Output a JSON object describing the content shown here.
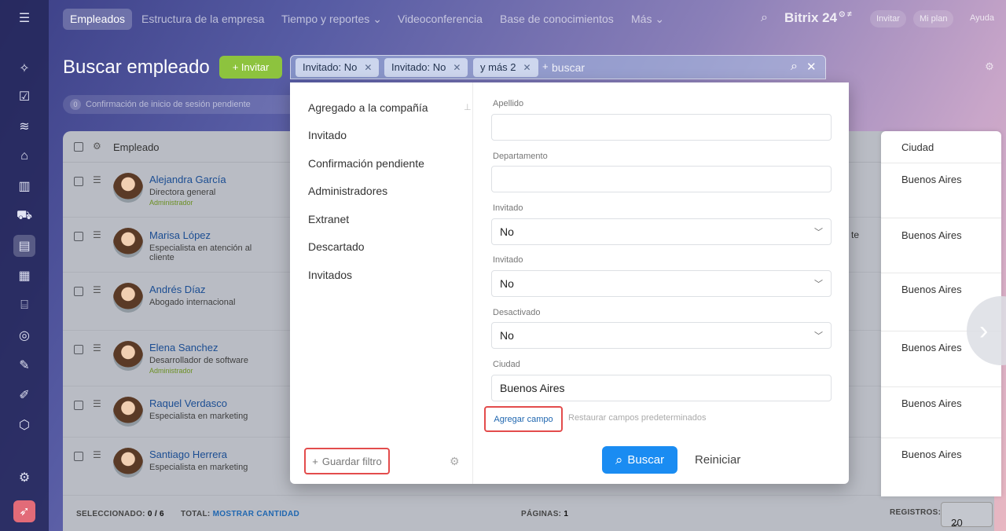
{
  "topbar": {
    "tabs": [
      {
        "label": "Empleados"
      },
      {
        "label": "Estructura de la empresa"
      },
      {
        "label": "Tiempo y reportes ⌄"
      },
      {
        "label": "Videoconferencia"
      },
      {
        "label": "Base de conocimientos"
      },
      {
        "label": "Más ⌄"
      }
    ],
    "logo": "Bitrix 24",
    "logo_suffix": "⊙ ≠",
    "invite": "Invitar",
    "plan": "Mi plan",
    "help": "Ayuda"
  },
  "page": {
    "title": "Buscar empleado",
    "invite_button": "+ Invitar",
    "pending_count": "0",
    "pending_label": "Confirmación de inicio de sesión pendiente"
  },
  "search": {
    "tags": [
      {
        "label": "Invitado: No"
      },
      {
        "label": "Invitado: No"
      },
      {
        "label": "y más 2"
      }
    ],
    "plus": "+",
    "placeholder": "buscar"
  },
  "filter": {
    "presets": [
      {
        "label": "Agregado a la compañía"
      },
      {
        "label": "Invitado"
      },
      {
        "label": "Confirmación pendiente"
      },
      {
        "label": "Administradores"
      },
      {
        "label": "Extranet"
      },
      {
        "label": "Descartado"
      },
      {
        "label": "Invitados"
      }
    ],
    "save_filter": "Guardar filtro",
    "fields": [
      {
        "label": "Apellido",
        "value": ""
      },
      {
        "label": "Departamento",
        "value": ""
      },
      {
        "label": "Invitado",
        "value": "No"
      },
      {
        "label": "Invitado",
        "value": "No"
      },
      {
        "label": "Desactivado",
        "value": "No"
      },
      {
        "label": "Ciudad",
        "value": "Buenos Aires"
      }
    ],
    "add_field": "Agregar campo",
    "restore_fields": "Restaurar campos predeterminados",
    "search_button": "Buscar",
    "reset_button": "Reiniciar"
  },
  "table": {
    "column_employee": "Empleado",
    "column_city": "Ciudad",
    "rows": [
      {
        "name": "Alejandra García",
        "position": "Directora general",
        "role": "Administrador",
        "city": "Buenos Aires"
      },
      {
        "name": "Marisa López",
        "position": "Especialista en atención al cliente",
        "role": "",
        "city": "Buenos Aires"
      },
      {
        "name": "Andrés Díaz",
        "position": "Abogado internacional",
        "role": "",
        "city": "Buenos Aires"
      },
      {
        "name": "Elena Sanchez",
        "position": "Desarrollador de software",
        "role": "Administrador",
        "city": "Buenos Aires"
      },
      {
        "name": "Raquel Verdasco",
        "position": "Especialista en marketing",
        "role": "",
        "city": "Buenos Aires"
      },
      {
        "name": "Santiago Herrera",
        "position": "Especialista en marketing",
        "role": "",
        "city": "Buenos Aires"
      }
    ],
    "stray_text": "te",
    "footer": {
      "selected_label": "SELECCIONADO:",
      "selected_value": "0 / 6",
      "total_label": "TOTAL:",
      "total_link": "MOSTRAR CANTIDAD",
      "pages_label": "PÁGINAS:",
      "pages_value": "1",
      "records_label": "REGISTROS:",
      "records_value": "20"
    }
  },
  "colors": {
    "accent": "#1a8cf2",
    "invite_green": "#8dc33e",
    "highlight_red": "#e34c4c"
  },
  "icons": {
    "rail": [
      "menu-icon",
      "sparkle-icon",
      "tasks-check-icon",
      "layers-icon",
      "robot-icon",
      "chart-bars-icon",
      "cart-icon",
      "employees-card-icon",
      "calendar-icon",
      "building-icon",
      "target-icon",
      "document-sign-icon",
      "pen-icon",
      "box-icon",
      "settings-icon",
      "rocket-icon"
    ]
  }
}
